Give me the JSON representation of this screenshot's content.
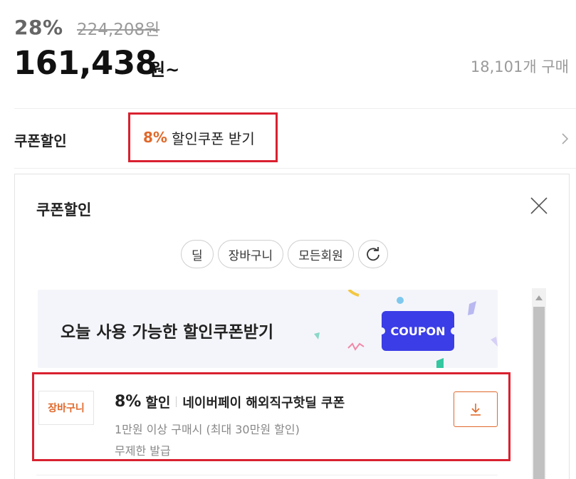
{
  "price": {
    "discount_rate": "28%",
    "original_price": "224,208원",
    "sale_price": "161,438",
    "sale_unit": "원~",
    "purchase_count": "18,101개 구매"
  },
  "coupon_row": {
    "label": "쿠폰할인",
    "link_pct": "8%",
    "link_text": "할인쿠폰 받기"
  },
  "panel": {
    "title": "쿠폰할인",
    "filters": [
      "딜",
      "장바구니",
      "모든회원"
    ],
    "refresh_icon": "refresh-icon",
    "close_icon": "close-icon"
  },
  "banner": {
    "text": "오늘 사용 가능한 할인쿠폰받기",
    "coupon_label": "COUPON"
  },
  "coupon_item": {
    "tag": "장바구니",
    "pct": "8%",
    "off": "할인",
    "name": "네이버페이 해외직구핫딜 쿠폰",
    "condition": "1만원 이상 구매시 (최대 30만원 할인)",
    "limit": "무제한 발급",
    "download_icon": "download-icon"
  },
  "colors": {
    "accent_orange": "#e0692b",
    "highlight_red": "#d92130",
    "coupon_blue": "#3b3de6"
  }
}
